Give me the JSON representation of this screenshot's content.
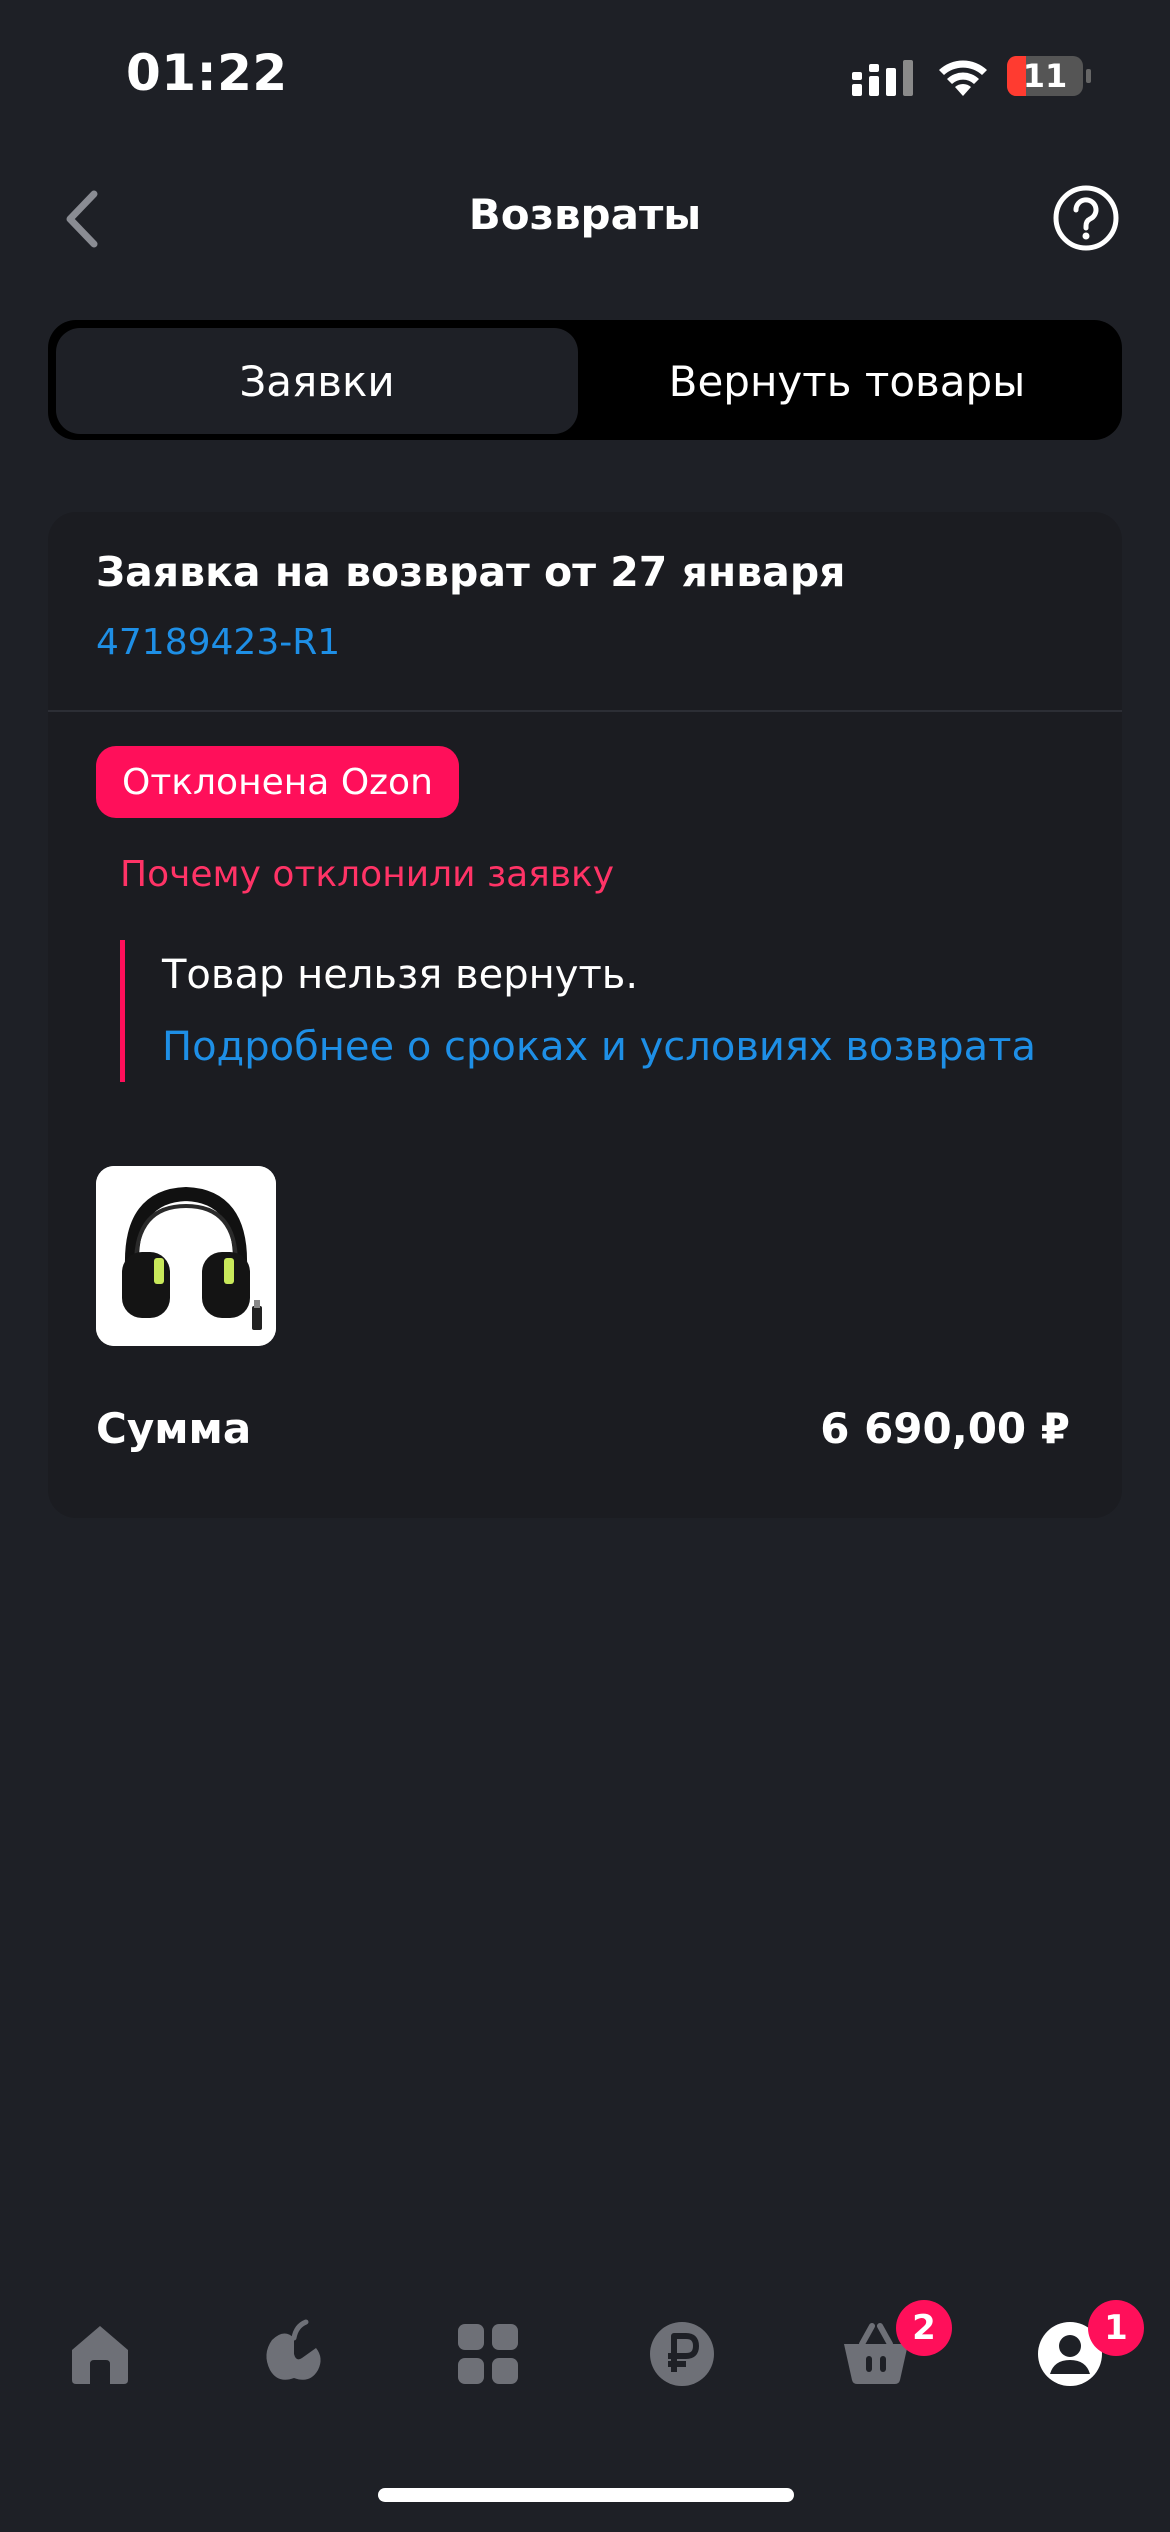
{
  "status_bar": {
    "time": "01:22",
    "battery": "11"
  },
  "header": {
    "title": "Возвраты"
  },
  "tabs": [
    {
      "label": "Заявки",
      "active": true
    },
    {
      "label": "Вернуть товары",
      "active": false
    }
  ],
  "return_request": {
    "title": "Заявка на возврат от 27 января",
    "id": "47189423-R1",
    "status_badge": "Отклонена Ozon",
    "reason_heading": "Почему отклонили заявку",
    "reason_text": "Товар нельзя вернуть.",
    "reason_link": "Подробнее о сроках и условиях возврата",
    "sum_label": "Сумма",
    "sum_value": "6 690,00 ₽"
  },
  "bottom_nav": {
    "items": [
      "home-icon",
      "fresh-icon",
      "catalog-icon",
      "finance-icon",
      "cart-icon",
      "profile-icon"
    ],
    "cart_badge": "2",
    "profile_badge": "1"
  },
  "colors": {
    "accent": "#ff0f5a",
    "link": "#1e8fe6",
    "background": "#1e2026"
  }
}
